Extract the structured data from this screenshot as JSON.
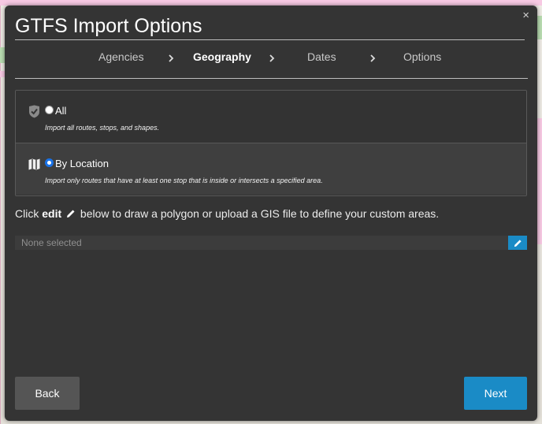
{
  "dialog": {
    "title": "GTFS Import Options",
    "close_label": "×"
  },
  "steps": [
    {
      "label": "Agencies",
      "active": false
    },
    {
      "label": "Geography",
      "active": true
    },
    {
      "label": "Dates",
      "active": false
    },
    {
      "label": "Options",
      "active": false
    }
  ],
  "geography": {
    "options": [
      {
        "label": "All",
        "description": "Import all routes, stops, and shapes.",
        "icon": "shield-check-icon",
        "selected": false
      },
      {
        "label": "By Location",
        "description": "Import only routes that have at least one stop that is inside or intersects a specified area.",
        "icon": "map-icon",
        "selected": true
      }
    ],
    "instruction": {
      "prefix": "Click ",
      "edit_word": "edit",
      "suffix": " below to draw a polygon or upload a GIS file to define your custom areas."
    },
    "area_field": {
      "value": "None selected"
    }
  },
  "footer": {
    "back_label": "Back",
    "next_label": "Next"
  },
  "colors": {
    "dialog_bg": "#343434",
    "accent": "#1a8bc6",
    "back_button": "#555555"
  }
}
